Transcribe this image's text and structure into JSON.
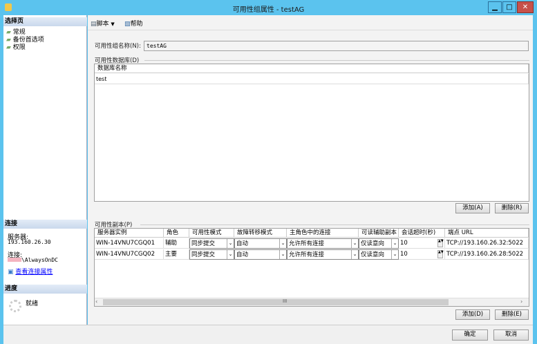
{
  "window": {
    "title": "可用性组属性 - testAG",
    "minimize": "▁",
    "maximize": "□",
    "close": "✕"
  },
  "left": {
    "select_page_header": "选择页",
    "pages": [
      {
        "label": "常规"
      },
      {
        "label": "备份首选项"
      },
      {
        "label": "权限"
      }
    ],
    "connection_header": "连接",
    "server_label": "服务器:",
    "server_value": "193.160.26.30",
    "connection_label": "连接:",
    "connection_value": "\\AlwaysOnDC",
    "view_props_link": "查看连接属性",
    "progress_header": "进度",
    "progress_status": "就绪"
  },
  "toolbar": {
    "script": "脚本",
    "help": "帮助"
  },
  "form": {
    "ag_name_label": "可用性组名称(N):",
    "ag_name_value": "testAG",
    "db_group": "可用性数据库(D)",
    "db_header": "数据库名称",
    "databases": [
      "test"
    ],
    "db_add": "添加(A)",
    "db_remove": "删除(R)",
    "replica_group": "可用性副本(P)",
    "replica_headers": [
      "服务器实例",
      "角色",
      "可用性模式",
      "故障转移模式",
      "主角色中的连接",
      "可读辅助副本",
      "会话超时(秒)",
      "端点 URL"
    ],
    "replicas": [
      [
        "WIN-14VNU7CGQ01",
        "辅助",
        "同步提交",
        "自动",
        "允许所有连接",
        "仅读意向",
        "10",
        "TCP://193.160.26.32:5022"
      ],
      [
        "WIN-14VNU7CGQ02",
        "主要",
        "同步提交",
        "自动",
        "允许所有连接",
        "仅读意向",
        "10",
        "TCP://193.160.26.28:5022"
      ]
    ],
    "replica_add": "添加(D)",
    "replica_remove": "删除(E)"
  },
  "footer": {
    "ok": "确定",
    "cancel": "取消"
  }
}
